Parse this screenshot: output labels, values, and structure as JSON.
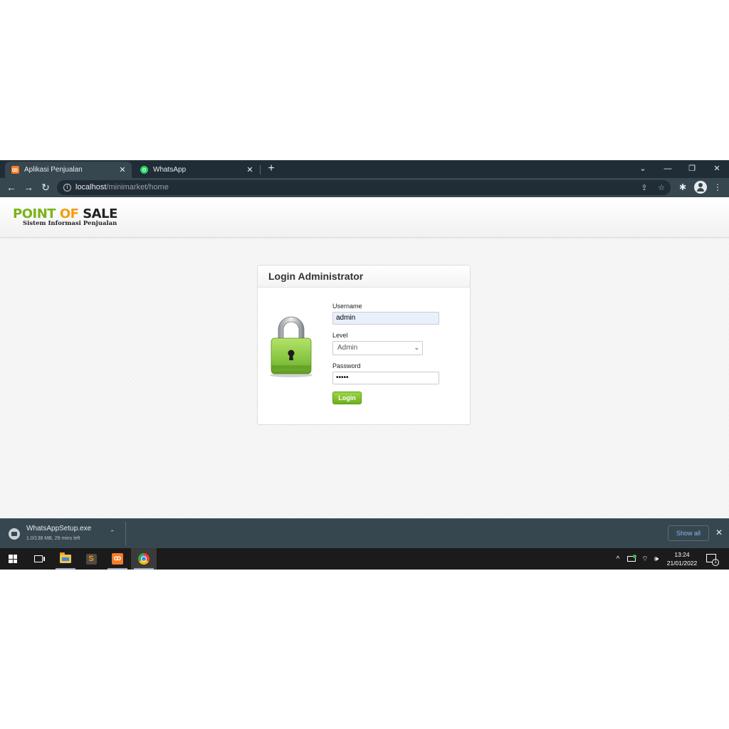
{
  "browser": {
    "tabs": [
      {
        "title": "Aplikasi Penjualan",
        "active": true,
        "icon": "xampp-icon"
      },
      {
        "title": "WhatsApp",
        "active": false,
        "icon": "whatsapp-icon"
      }
    ],
    "tab_close_glyph": "✕",
    "new_tab_glyph": "+",
    "window_controls": {
      "dropdown": "⌄",
      "minimize": "—",
      "restore": "❐",
      "close": "✕"
    },
    "nav": {
      "back": "←",
      "forward": "→",
      "reload": "↻"
    },
    "url_host": "localhost",
    "url_path": "/minimarket/home",
    "toolbar_icons": {
      "share": "⇪",
      "bookmark": "☆",
      "extensions": "✱",
      "menu": "⋮"
    }
  },
  "site": {
    "logo_word1": "POINT",
    "logo_word2": "OF",
    "logo_word3": "SALE",
    "tagline": "Sistem Informasi Penjualan",
    "colors": {
      "logo_green": "#7ab317",
      "logo_orange": "#f39c12",
      "login_button": "#7ab317"
    }
  },
  "login": {
    "title": "Login Administrator",
    "username_label": "Username",
    "username_value": "admin",
    "level_label": "Level",
    "level_selected": "Admin",
    "password_label": "Password",
    "password_value": "•••••",
    "button_label": "Login"
  },
  "download_shelf": {
    "file_name": "WhatsAppSetup.exe",
    "status": "1.0/138 MB, 29 mins left",
    "caret": "⌃",
    "show_all_label": "Show all",
    "close_glyph": "✕"
  },
  "taskbar": {
    "apps": [
      "start-icon",
      "task-view-icon",
      "file-explorer-icon",
      "sublime-text-icon",
      "xampp-icon",
      "chrome-icon"
    ],
    "tray_chevron": "^",
    "tray_network": "⌔",
    "tray_volume": "🕪",
    "time": "13:24",
    "date": "21/01/2022",
    "notification_count": "1"
  }
}
